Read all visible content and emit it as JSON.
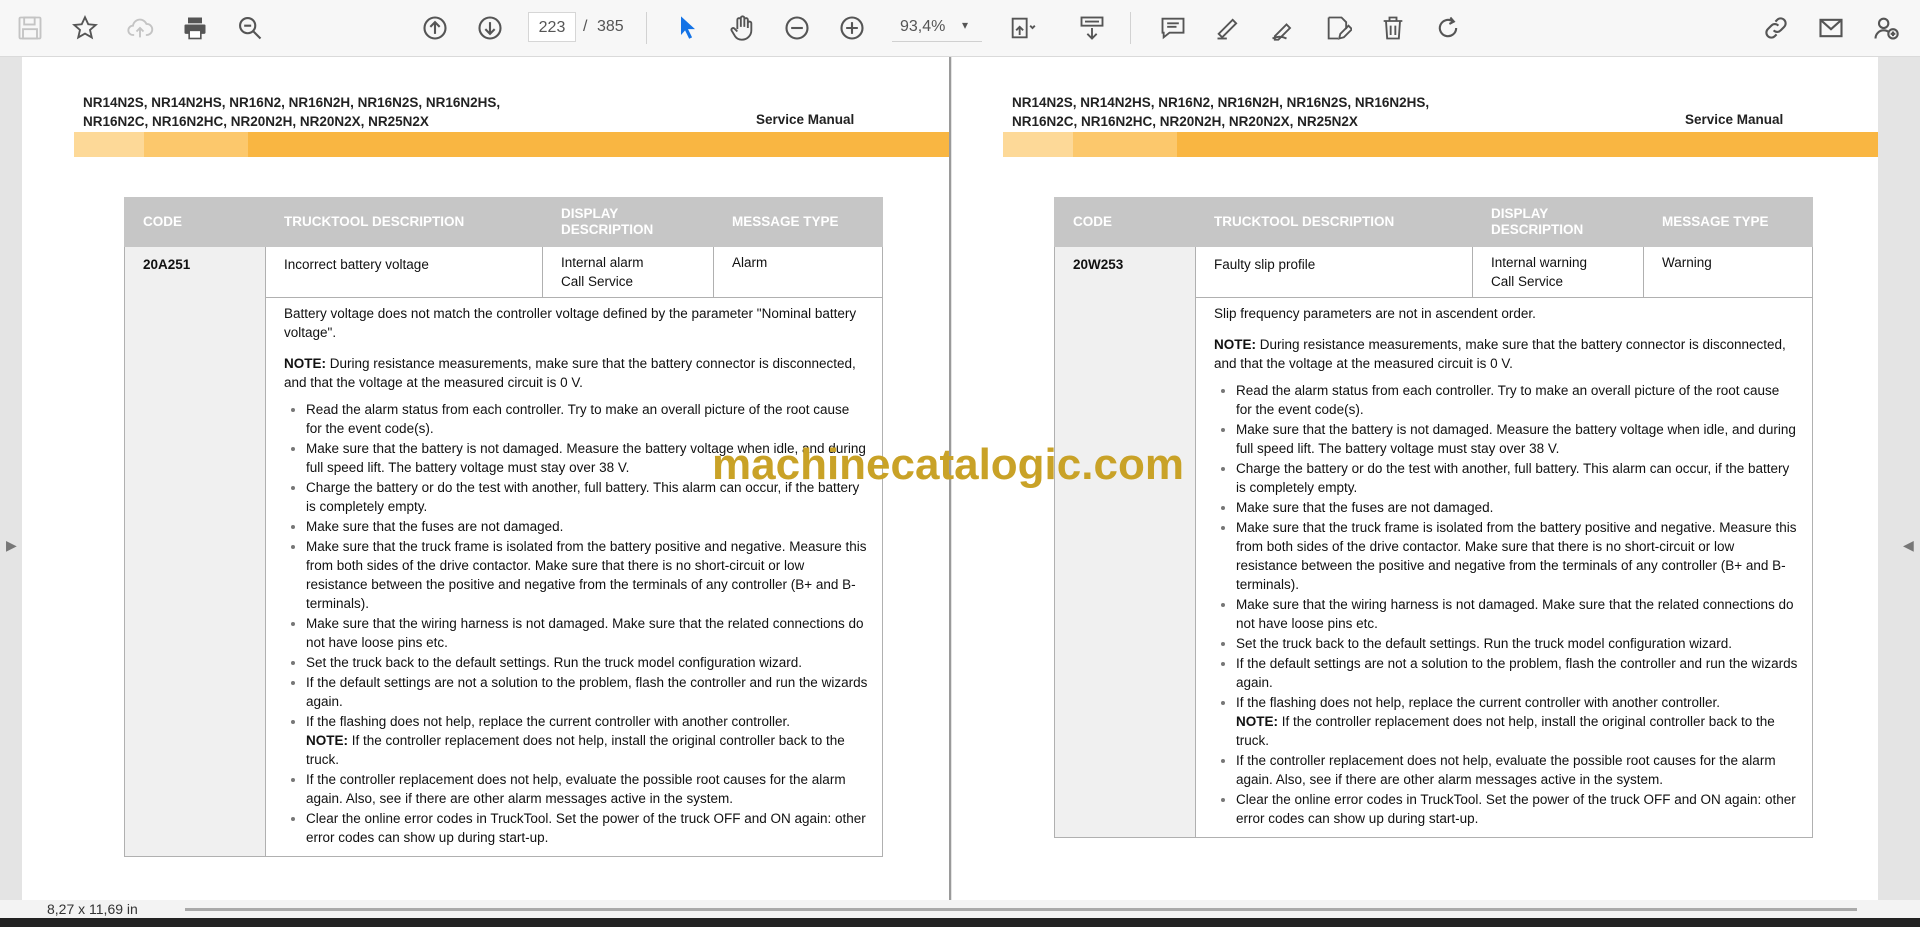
{
  "toolbar": {
    "current_page": "223",
    "page_separator": "/",
    "total_pages": "385",
    "zoom": "93,4%",
    "zoom_caret": "▾"
  },
  "status": {
    "page_size": "8,27 x 11,69 in"
  },
  "watermark": "machinecatalogic.com",
  "pages": [
    {
      "models": "NR14N2S, NR14N2HS, NR16N2, NR16N2H, NR16N2S, NR16N2HS,\nNR16N2C, NR16N2HC, NR20N2H, NR20N2X, NR25N2X",
      "doc_type": "Service Manual",
      "table": {
        "headers": [
          "CODE",
          "TRUCKTOOL DESCRIPTION",
          "DISPLAY\nDESCRIPTION",
          "MESSAGE TYPE"
        ],
        "code": "20A251",
        "trucktool_description": "Incorrect battery voltage",
        "display_description_1": "Internal alarm",
        "display_description_2": "Call Service",
        "message_type": "Alarm",
        "intro": "Battery voltage does not match the controller voltage defined by the parameter \"Nominal battery voltage\".",
        "note_label": "NOTE:",
        "note_text": " During resistance measurements, make sure that the battery connector is disconnected, and that the voltage at the measured circuit is 0 V.",
        "steps": [
          "Read the alarm status from each controller. Try to make an overall picture of the root cause for the event code(s).",
          "Make sure that the battery is not damaged. Measure the battery voltage when idle, and during full speed lift. The battery voltage must stay over 38 V.",
          "Charge the battery or do the test with another, full battery. This alarm can occur, if the battery is completely empty.",
          "Make sure that the fuses are not damaged.",
          "Make sure that the truck frame is isolated from the battery positive and negative. Measure this from both sides of the drive contactor. Make sure that there is no short-circuit or low resistance between the positive and negative from the terminals of any controller (B+ and B- terminals).",
          "Make sure that the wiring harness is not damaged. Make sure that the related connections do not have loose pins etc.",
          "Set the truck back to the default settings. Run the truck model configuration wizard.",
          "If the default settings are not a solution to the problem, flash the controller and run the wizards again.",
          "If the flashing does not help, replace the current controller with another controller.",
          "If the controller replacement does not help, evaluate the possible root causes for the alarm again. Also, see if there are other alarm messages active in the system.",
          "Clear the online error codes in TruckTool. Set the power of the truck OFF and ON again: other error codes can show up during start-up."
        ],
        "step9_note_label": "NOTE:",
        "step9_note_text": " If the controller replacement does not help, install the original controller back to the truck."
      }
    },
    {
      "models": "NR14N2S, NR14N2HS, NR16N2, NR16N2H, NR16N2S, NR16N2HS,\nNR16N2C, NR16N2HC, NR20N2H, NR20N2X, NR25N2X",
      "doc_type": "Service Manual",
      "table": {
        "headers": [
          "CODE",
          "TRUCKTOOL DESCRIPTION",
          "DISPLAY\nDESCRIPTION",
          "MESSAGE TYPE"
        ],
        "code": "20W253",
        "trucktool_description": "Faulty slip profile",
        "display_description_1": "Internal warning",
        "display_description_2": "Call Service",
        "message_type": "Warning",
        "intro": "Slip frequency parameters are not in ascendent order.",
        "note_label": "NOTE:",
        "note_text": " During resistance measurements, make sure that the battery connector is disconnected, and that the voltage at the measured circuit is 0 V.",
        "steps": [
          "Read the alarm status from each controller. Try to make an overall picture of the root cause for the event code(s).",
          "Make sure that the battery is not damaged. Measure the battery voltage when idle, and during full speed lift. The battery voltage must stay over 38 V.",
          "Charge the battery or do the test with another, full battery. This alarm can occur, if the battery is completely empty.",
          "Make sure that the fuses are not damaged.",
          "Make sure that the truck frame is isolated from the battery positive and negative. Measure this from both sides of the drive contactor. Make sure that there is no short-circuit or low resistance between the positive and negative from the terminals of any controller (B+ and B- terminals).",
          "Make sure that the wiring harness is not damaged. Make sure that the related connections do not have loose pins etc.",
          "Set the truck back to the default settings. Run the truck model configuration wizard.",
          "If the default settings are not a solution to the problem, flash the controller and run the wizards again.",
          "If the flashing does not help, replace the current controller with another controller.",
          "If the controller replacement does not help, evaluate the possible root causes for the alarm again. Also, see if there are other alarm messages active in the system.",
          "Clear the online error codes in TruckTool. Set the power of the truck OFF and ON again: other error codes can show up during start-up."
        ],
        "step9_note_label": "NOTE:",
        "step9_note_text": " If the controller replacement does not help, install the original controller back to the truck."
      }
    }
  ],
  "colors": {
    "accent_orange": "#f9b642",
    "tool_active": "#1473e6",
    "watermark": "#c9a227",
    "table_header": "#c6c6c6"
  }
}
